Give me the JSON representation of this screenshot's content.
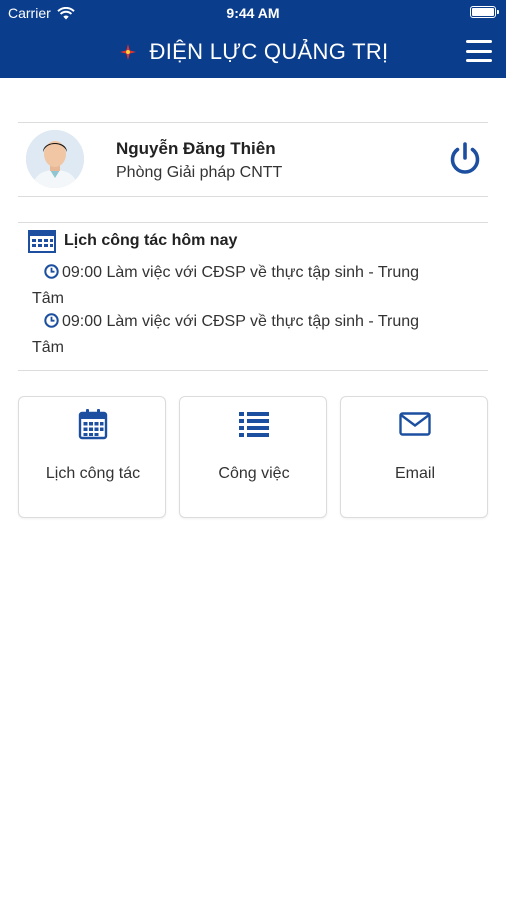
{
  "colors": {
    "header_bg": "#0a3e8c",
    "icon_blue": "#1d4fa0",
    "divider": "#dcdcdc"
  },
  "status_bar": {
    "carrier": "Carrier",
    "time": "9:44 AM"
  },
  "header": {
    "title": "ĐIỆN LỰC QUẢNG TRỊ",
    "logo_icon": "star-logo-icon",
    "menu_icon": "hamburger-menu-icon"
  },
  "profile": {
    "name": "Nguyễn Đăng Thiên",
    "department": "Phòng Giải pháp CNTT",
    "power_icon": "power-icon"
  },
  "schedule": {
    "title": "Lịch công tác hôm nay",
    "items": [
      {
        "line1": "09:00 Làm việc với CĐSP về thực tập sinh - Trung",
        "line2": "Tâm"
      },
      {
        "line1": "09:00 Làm việc với CĐSP về thực tập sinh - Trung",
        "line2": "Tâm"
      }
    ]
  },
  "tiles": [
    {
      "label": "Lịch công tác",
      "icon": "calendar-icon"
    },
    {
      "label": "Công việc",
      "icon": "list-icon"
    },
    {
      "label": "Email",
      "icon": "envelope-icon"
    }
  ]
}
